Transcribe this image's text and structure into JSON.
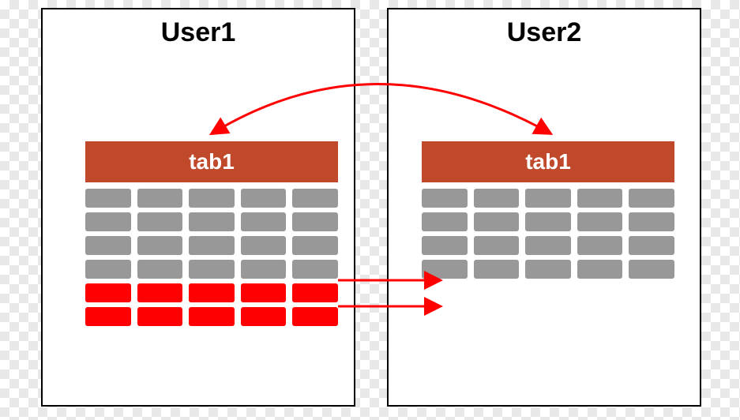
{
  "panels": {
    "user1": {
      "title": "User1",
      "tab_label": "tab1",
      "gray_rows": 4,
      "red_rows": 2,
      "cols": 5
    },
    "user2": {
      "title": "User2",
      "tab_label": "tab1",
      "gray_rows": 4,
      "red_rows": 0,
      "cols": 5
    }
  },
  "colors": {
    "panel_border": "#000000",
    "tab_header_bg": "#c0492b",
    "tab_header_text": "#ffffff",
    "cell_gray": "#989898",
    "cell_red": "#ff0000",
    "arrow_red": "#ff0000"
  },
  "arrows": {
    "curved_bidirectional": true,
    "straight_arrows_count": 2
  }
}
